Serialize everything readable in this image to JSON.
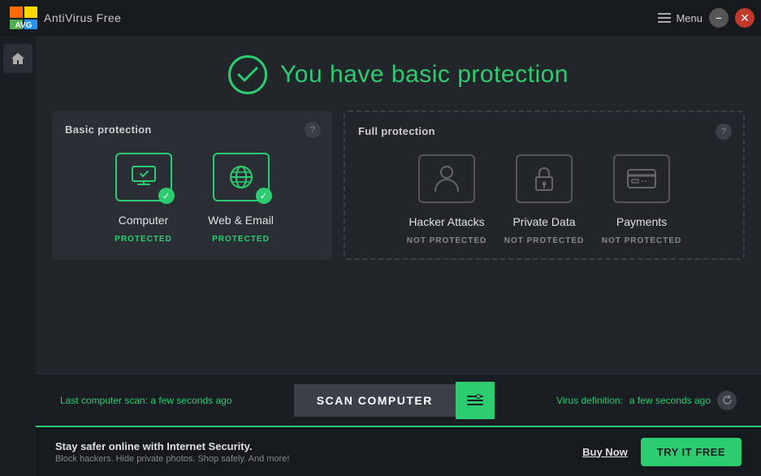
{
  "titleBar": {
    "appName": "AntiVirus Free",
    "menuLabel": "Menu",
    "minBtn": "−",
    "closeBtn": "✕"
  },
  "header": {
    "title": "You have basic protection"
  },
  "basicProtection": {
    "sectionTitle": "Basic protection",
    "items": [
      {
        "name": "Computer",
        "status": "PROTECTED",
        "protected": true
      },
      {
        "name": "Web & Email",
        "status": "PROTECTED",
        "protected": true
      }
    ]
  },
  "fullProtection": {
    "sectionTitle": "Full protection",
    "items": [
      {
        "name": "Hacker Attacks",
        "status": "NOT PROTECTED",
        "protected": false
      },
      {
        "name": "Private Data",
        "status": "NOT PROTECTED",
        "protected": false
      },
      {
        "name": "Payments",
        "status": "NOT PROTECTED",
        "protected": false
      }
    ]
  },
  "scanBar": {
    "lastScanLabel": "Last computer scan:",
    "lastScanTime": "a few seconds ago",
    "scanButtonLabel": "SCAN COMPUTER",
    "virusDefLabel": "Virus definition:",
    "virusDefTime": "a few seconds ago"
  },
  "promoBar": {
    "headline": "Stay safer online with Internet Security.",
    "subtext": "Block hackers. Hide private photos. Shop safely. And more!",
    "buyNowLabel": "Buy Now",
    "tryFreeLabel": "TRY IT FREE"
  }
}
